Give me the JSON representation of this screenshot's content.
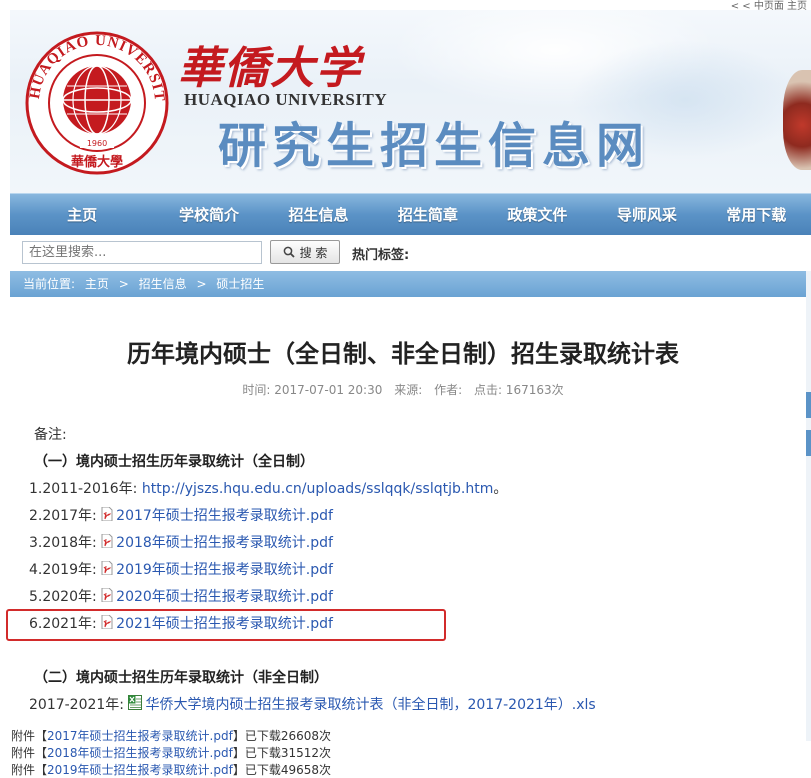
{
  "topbar": {
    "links": "< < 中页面 主页"
  },
  "banner": {
    "cn_name": "華僑大学",
    "en_name": "HUAQIAO UNIVERSITY",
    "site_title": "研究生招生信息网",
    "logo_ring": "HUAQIAO UNIVERSITY",
    "logo_year": "1960",
    "logo_script": "華僑大學"
  },
  "nav": {
    "items": [
      "主页",
      "学校简介",
      "招生信息",
      "招生简章",
      "政策文件",
      "导师风采",
      "常用下载"
    ]
  },
  "search": {
    "placeholder": "在这里搜索...",
    "button": "搜 索",
    "hot_tags_label": "热门标签:"
  },
  "breadcrumb": {
    "prefix": "当前位置:",
    "items": [
      "主页",
      "招生信息",
      "硕士招生"
    ],
    "sep": ">"
  },
  "article": {
    "title": "历年境内硕士（全日制、非全日制）招生录取统计表",
    "meta": {
      "time": "时间: 2017-07-01 20:30",
      "source": "来源:",
      "author": "作者:",
      "clicks": "点击: 167163次"
    },
    "note": "备注:",
    "section1": "（一）境内硕士招生历年录取统计（全日制）",
    "rows": [
      {
        "label": "1.2011-2016年: ",
        "link": "http://yjszs.hqu.edu.cn/uploads/sslqqk/sslqtjb.htm",
        "suffix": "。"
      },
      {
        "label": "2.2017年: ",
        "file": "2017年硕士招生报考录取统计.pdf"
      },
      {
        "label": "3.2018年: ",
        "file": "2018年硕士招生报考录取统计.pdf"
      },
      {
        "label": "4.2019年: ",
        "file": "2019年硕士招生报考录取统计.pdf"
      },
      {
        "label": "5.2020年: ",
        "file": "2020年硕士招生报考录取统计.pdf"
      },
      {
        "label": "6.2021年: ",
        "file": "2021年硕士招生报考录取统计.pdf"
      }
    ],
    "section2": "（二）境内硕士招生历年录取统计（非全日制）",
    "row2": {
      "label": "2017-2021年: ",
      "file": "华侨大学境内硕士招生报考录取统计表（非全日制，2017-2021年）.xls"
    }
  },
  "attachments": [
    {
      "prefix": "附件【",
      "file": "2017年硕士招生报考录取统计.pdf",
      "suffix": "】已下载26608次"
    },
    {
      "prefix": "附件【",
      "file": "2018年硕士招生报考录取统计.pdf",
      "suffix": "】已下载31512次"
    },
    {
      "prefix": "附件【",
      "file": "2019年硕士招生报考录取统计.pdf",
      "suffix": "】已下载49658次"
    }
  ],
  "colors": {
    "accent": "#5b93c7",
    "link": "#2a58b0",
    "brand_red": "#c41a1f",
    "highlight": "#d22b2b"
  }
}
